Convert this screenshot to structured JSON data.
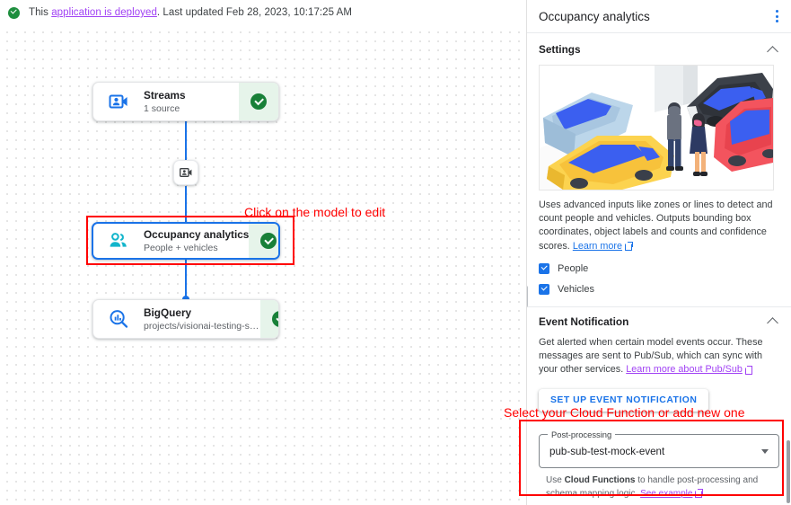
{
  "status_bar": {
    "icon": "check-circle-icon",
    "prefix": "This ",
    "link": "application is deployed",
    "suffix": ". Last updated Feb 28, 2023, 10:17:25 AM"
  },
  "canvas": {
    "nodes": [
      {
        "id": "streams",
        "icon": "video-camera-person-icon",
        "title": "Streams",
        "subtitle": "1 source",
        "status": "ok"
      },
      {
        "id": "occupancy",
        "icon": "people-group-icon",
        "title": "Occupancy analytics",
        "subtitle": "People + vehicles",
        "status": "ok",
        "selected": true
      },
      {
        "id": "bigquery",
        "icon": "bigquery-search-icon",
        "title": "BigQuery",
        "subtitle": "projects/visionai-testing-stabl...",
        "status": "ok"
      }
    ],
    "mini_node": {
      "icon": "video-camera-icon"
    },
    "annotations": [
      {
        "id": "model-hint",
        "text": "Click on the model to edit",
        "color": "#ff0000"
      }
    ]
  },
  "panel": {
    "title": "Occupancy analytics",
    "menu_icon": "kebab-menu-icon",
    "settings": {
      "heading": "Settings",
      "collapse_icon": "chevron-up-icon",
      "illustration_alt": "parking-lot-cars-people-illustration",
      "description": "Uses advanced inputs like zones or lines to detect and count people and vehicles. Outputs bounding box coordinates, object labels and counts and confidence scores.",
      "learn_more": "Learn more",
      "checkboxes": [
        {
          "label": "People",
          "checked": true
        },
        {
          "label": "Vehicles",
          "checked": true
        }
      ]
    },
    "event_notification": {
      "heading": "Event Notification",
      "collapse_icon": "chevron-up-icon",
      "description": "Get alerted when certain model events occur. These messages are sent to Pub/Sub, which can sync with your other services.",
      "link": "Learn more about Pub/Sub",
      "button": "SET UP EVENT NOTIFICATION"
    },
    "post_processing": {
      "label": "Post-processing",
      "value": "pub-sub-test-mock-event",
      "dropdown_icon": "chevron-down-icon",
      "help_prefix": "Use ",
      "help_bold": "Cloud Functions",
      "help_suffix": " to handle post-processing and schema mapping logic. ",
      "help_link": "See example",
      "annotation": "Select your Cloud Function or add new one"
    }
  },
  "colors": {
    "accent_blue": "#1a73e8",
    "visited_purple": "#a142f4",
    "success_green": "#188038",
    "annotation_red": "#ff0000",
    "teal_icon": "#12b5cb"
  }
}
